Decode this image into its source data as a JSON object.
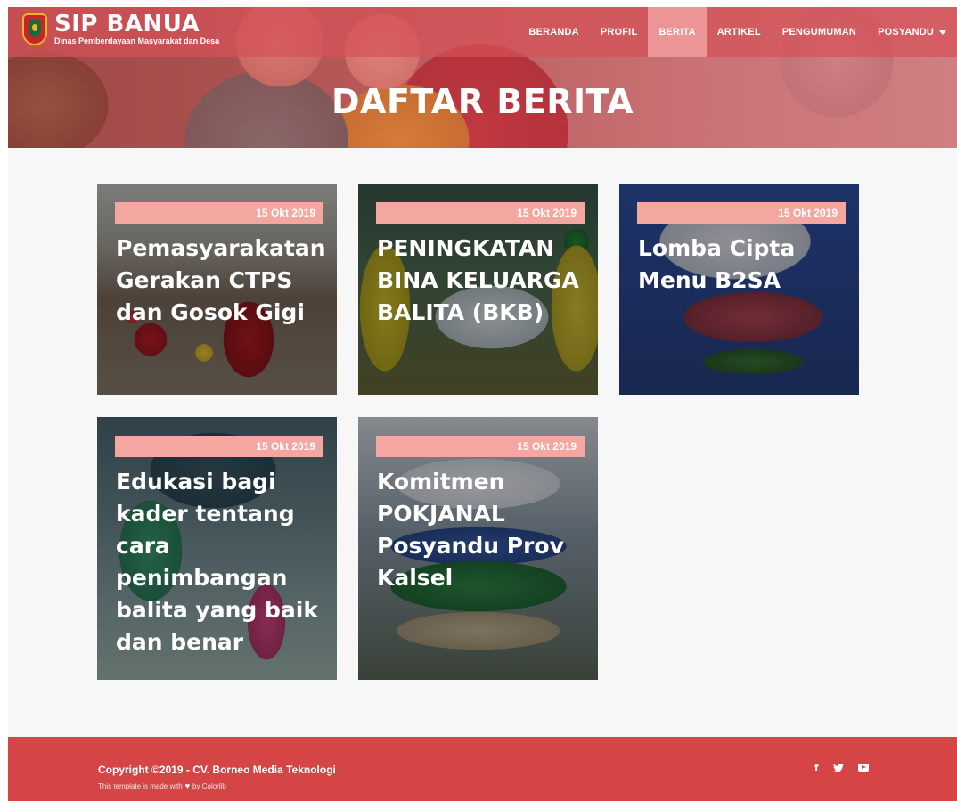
{
  "brand": {
    "title": "SIP BANUA",
    "subtitle": "Dinas Pemberdayaan Masyarakat dan Desa"
  },
  "nav": {
    "items": [
      {
        "label": "BERANDA"
      },
      {
        "label": "PROFIL"
      },
      {
        "label": "BERITA"
      },
      {
        "label": "ARTIKEL"
      },
      {
        "label": "PENGUMUMAN"
      },
      {
        "label": "POSYANDU"
      }
    ],
    "active": "BERITA"
  },
  "page": {
    "title": "DAFTAR BERITA"
  },
  "news": [
    {
      "date": "15 Okt 2019",
      "title": "Pemasyarakatan Gerakan CTPS dan Gosok Gigi"
    },
    {
      "date": "15 Okt 2019",
      "title": "PENINGKATAN BINA KELUARGA BALITA (BKB)"
    },
    {
      "date": "15 Okt 2019",
      "title": "Lomba Cipta Menu B2SA"
    },
    {
      "date": "15 Okt 2019",
      "title": "Edukasi bagi kader tentang cara penimbangan balita yang baik dan benar"
    },
    {
      "date": "15 Okt 2019",
      "title": "Komitmen POKJANAL Posyandu Prov Kalsel"
    }
  ],
  "footer": {
    "copyright": "Copyright ©2019 - CV. Borneo Media Teknologi",
    "credit_prefix": "This template is made with",
    "credit_suffix": "by Colorlib",
    "social": [
      "facebook-icon",
      "twitter-icon",
      "youtube-icon"
    ]
  },
  "colors": {
    "accent": "#d64545",
    "date_badge": "#f4a7a0"
  }
}
